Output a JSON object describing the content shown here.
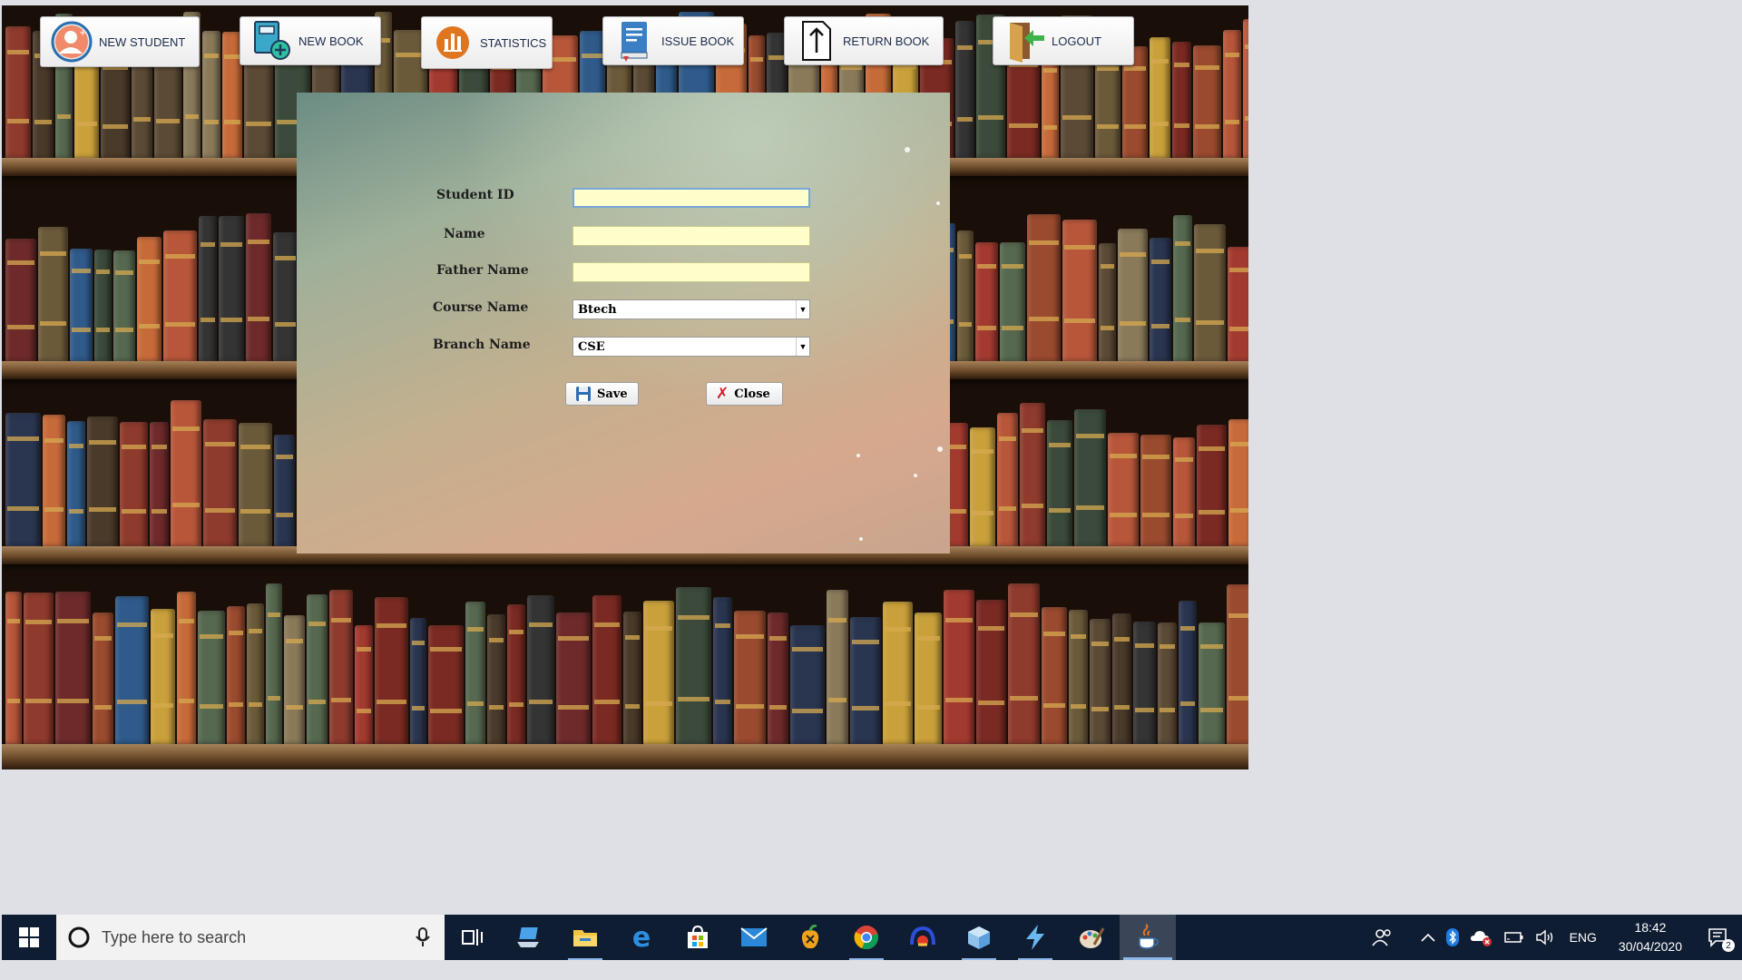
{
  "toolbar": {
    "new_student": "NEW STUDENT",
    "new_book": "NEW BOOK",
    "statistics": "STATISTICS",
    "issue_book": "ISSUE BOOK",
    "return_book": "RETURN BOOK",
    "logout": "LOGOUT"
  },
  "form": {
    "student_id_label": "Student ID",
    "student_id_value": "",
    "name_label": "Name",
    "name_value": "",
    "father_name_label": "Father Name",
    "father_name_value": "",
    "course_label": "Course Name",
    "course_value": "Btech",
    "branch_label": "Branch Name",
    "branch_value": "CSE",
    "save_label": "Save",
    "close_label": "Close"
  },
  "taskbar": {
    "search_placeholder": "Type here to search",
    "lang": "ENG",
    "time": "18:42",
    "date": "30/04/2020",
    "notifications": "2",
    "apps": [
      "task-view-icon",
      "laptop-icon",
      "file-explorer-icon",
      "edge-icon",
      "store-icon",
      "mail-icon",
      "fruit-app-icon",
      "chrome-icon",
      "fan-app-icon",
      "3d-box-icon",
      "bolt-app-icon",
      "paint-icon",
      "java-icon"
    ]
  },
  "colors": {
    "input_bg": "#ffffcc",
    "taskbar_bg": "#0f1d33",
    "toolbar_text": "#1b2a4a"
  }
}
